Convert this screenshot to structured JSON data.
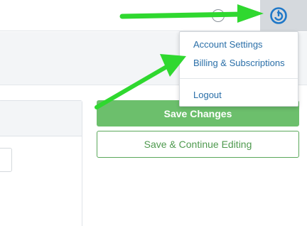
{
  "topbar": {
    "help_icon": "question-circle-icon",
    "power_icon": "power-icon",
    "accent_color": "#1f78c8"
  },
  "dropdown": {
    "items": [
      {
        "label": "Account Settings"
      },
      {
        "label": "Billing & Subscriptions"
      }
    ],
    "logout_label": "Logout"
  },
  "actions": {
    "save_label": "Save Changes",
    "continue_label": "Save & Continue Editing",
    "primary_color": "#6cbf6c"
  },
  "annotations": {
    "arrow_color": "#33dd33"
  }
}
